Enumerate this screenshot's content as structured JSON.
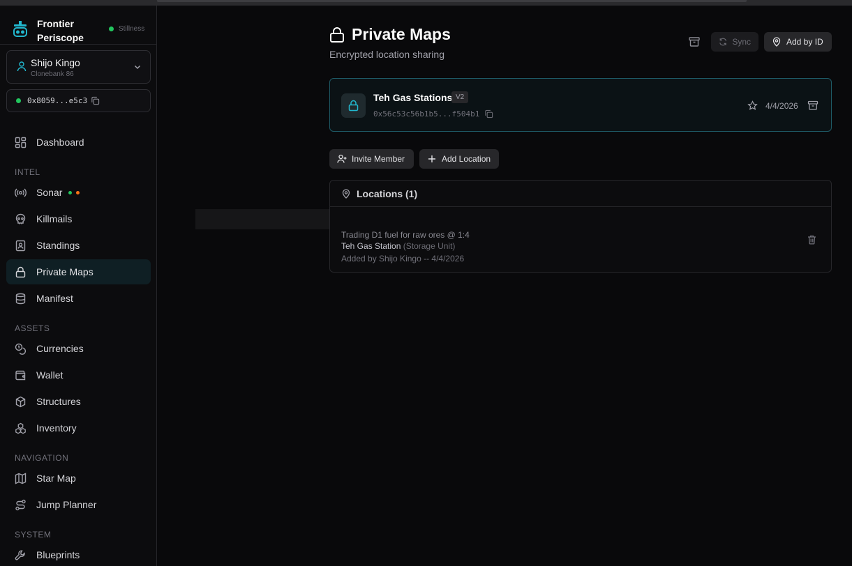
{
  "app": {
    "brand_name": "Frontier Periscope",
    "server_status": "Stillness",
    "status_color": "#22c55e",
    "accent_color": "#22b8cf"
  },
  "user": {
    "name": "Shijo Kingo",
    "subtitle": "Clonebank 86",
    "wallet_address": "0x8059...e5c3"
  },
  "sidebar": {
    "items": [
      {
        "label": "Dashboard",
        "icon": "dashboard-icon"
      },
      {
        "label": "Sonar",
        "icon": "radio-icon"
      },
      {
        "label": "Killmails",
        "icon": "skull-icon"
      },
      {
        "label": "Standings",
        "icon": "contact-icon"
      },
      {
        "label": "Private Maps",
        "icon": "lock-icon",
        "active": true
      },
      {
        "label": "Manifest",
        "icon": "database-icon"
      },
      {
        "label": "Currencies",
        "icon": "coins-icon"
      },
      {
        "label": "Wallet",
        "icon": "wallet-icon"
      },
      {
        "label": "Structures",
        "icon": "box-icon"
      },
      {
        "label": "Inventory",
        "icon": "boxes-icon"
      },
      {
        "label": "Star Map",
        "icon": "map-icon"
      },
      {
        "label": "Jump Planner",
        "icon": "route-icon"
      },
      {
        "label": "Blueprints",
        "icon": "wrench-icon"
      }
    ],
    "sections": {
      "intel": "INTEL",
      "assets": "ASSETS",
      "navigation": "NAVIGATION",
      "system": "SYSTEM"
    }
  },
  "page": {
    "title": "Private Maps",
    "subtitle": "Encrypted location sharing",
    "sync_label": "Sync",
    "add_by_id_label": "Add by ID"
  },
  "map": {
    "name": "Teh Gas Stations",
    "version": "V2",
    "object_id": "0x56c53c56b1b5...f504b1",
    "date": "4/4/2026"
  },
  "actions": {
    "invite_member": "Invite Member",
    "add_location": "Add Location"
  },
  "locations": {
    "header": "Locations (1)",
    "items": [
      {
        "note": "Trading D1 fuel for raw ores @ 1:4",
        "name": "Teh Gas Station",
        "type": "(Storage Unit)",
        "added_by": "Added by Shijo Kingo -- 4/4/2026"
      }
    ]
  }
}
